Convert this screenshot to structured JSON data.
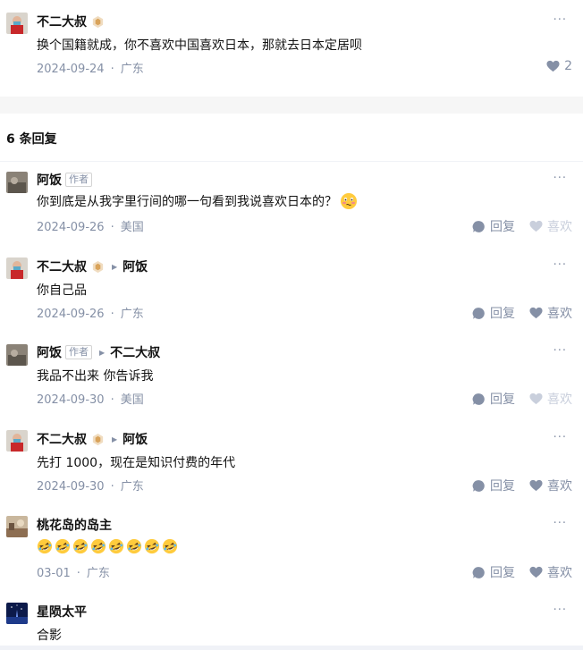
{
  "parent": {
    "author": "不二大叔",
    "text": "换个国籍就成，你不喜欢中国喜欢日本，那就去日本定居呗",
    "date": "2024-09-24",
    "location": "广东",
    "like_count": "2",
    "more": "···"
  },
  "replies_header": "6 条回复",
  "replies": [
    {
      "author": "阿饭",
      "author_tag": "作者",
      "text": "你到底是从我字里行间的哪一句看到我说喜欢日本的？",
      "date": "2024-09-26",
      "location": "美国",
      "reply_label": "回复",
      "like_label": "喜欢"
    },
    {
      "author": "不二大叔",
      "target": "阿饭",
      "text": "你自己品",
      "date": "2024-09-26",
      "location": "广东",
      "reply_label": "回复",
      "like_label": "喜欢"
    },
    {
      "author": "阿饭",
      "author_tag": "作者",
      "target": "不二大叔",
      "text": "我品不出来 你告诉我",
      "date": "2024-09-30",
      "location": "美国",
      "reply_label": "回复",
      "like_label": "喜欢"
    },
    {
      "author": "不二大叔",
      "target": "阿饭",
      "text": "先打 1000，现在是知识付费的年代",
      "date": "2024-09-30",
      "location": "广东",
      "reply_label": "回复",
      "like_label": "喜欢"
    },
    {
      "author": "桃花岛的岛主",
      "text": "",
      "date": "03-01",
      "location": "广东",
      "reply_label": "回复",
      "like_label": "喜欢"
    },
    {
      "author": "星陨太平",
      "text": "合影"
    }
  ],
  "separator": "·",
  "icons": {
    "more": "more-dots-icon",
    "reply": "comment-bubble-icon",
    "like": "heart-icon",
    "badge": "hexagon-badge-icon",
    "emoji_smile": "blushing-emoji-icon",
    "emoji_laugh": "rofl-emoji-icon"
  }
}
